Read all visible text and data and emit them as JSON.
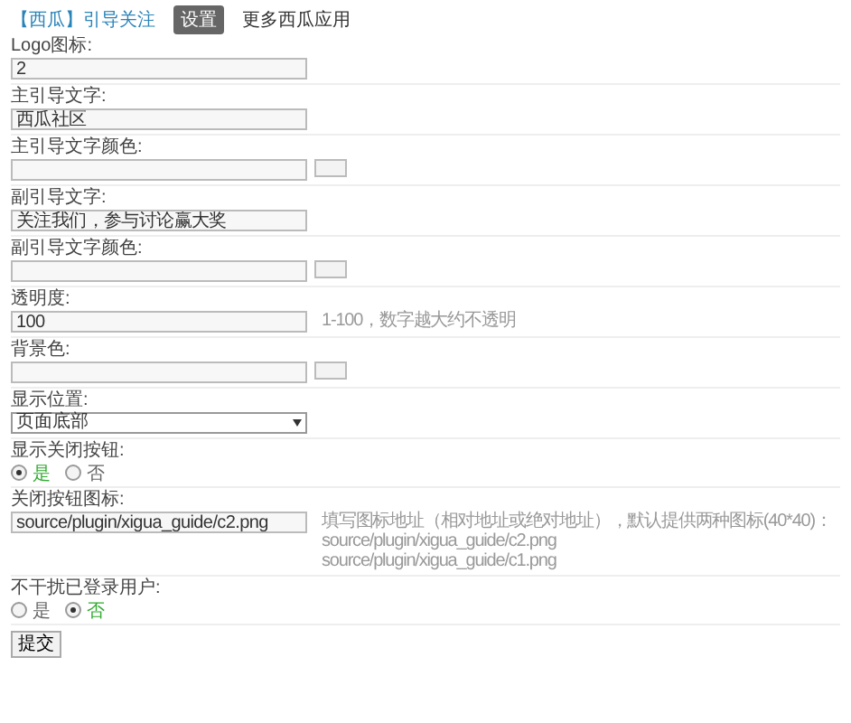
{
  "header": {
    "title": "【西瓜】引导关注",
    "tabs": [
      {
        "label": "设置",
        "selected": true
      }
    ],
    "link": "更多西瓜应用"
  },
  "fields": [
    {
      "kind": "text",
      "label": "Logo图标:",
      "value": "2"
    },
    {
      "kind": "text",
      "label": "主引导文字:",
      "value": "西瓜社区"
    },
    {
      "kind": "color",
      "label": "主引导文字颜色:"
    },
    {
      "kind": "text",
      "label": "副引导文字:",
      "value": "关注我们，参与讨论赢大奖"
    },
    {
      "kind": "color",
      "label": "副引导文字颜色:"
    },
    {
      "kind": "text",
      "label": "透明度:",
      "value": "100",
      "hint": [
        "1-100，数字越大约不透明"
      ]
    },
    {
      "kind": "color",
      "label": "背景色:"
    },
    {
      "kind": "select",
      "label": "显示位置:",
      "value": "页面底部"
    },
    {
      "kind": "radio",
      "label": "显示关闭按钮:",
      "options": [
        {
          "label": "是",
          "selected": true
        },
        {
          "label": "否",
          "selected": false
        }
      ]
    },
    {
      "kind": "text",
      "label": "关闭按钮图标:",
      "value": "source/plugin/xigua_guide/c2.png",
      "hint": [
        "填写图标地址（相对地址或绝对地址），默认提供两种图标(40*40)：",
        "source/plugin/xigua_guide/c2.png",
        "source/plugin/xigua_guide/c1.png"
      ]
    },
    {
      "kind": "radio",
      "label": "不干扰已登录用户:",
      "options": [
        {
          "label": "是",
          "selected": false
        },
        {
          "label": "否",
          "selected": true
        }
      ]
    }
  ],
  "submit": "提交"
}
